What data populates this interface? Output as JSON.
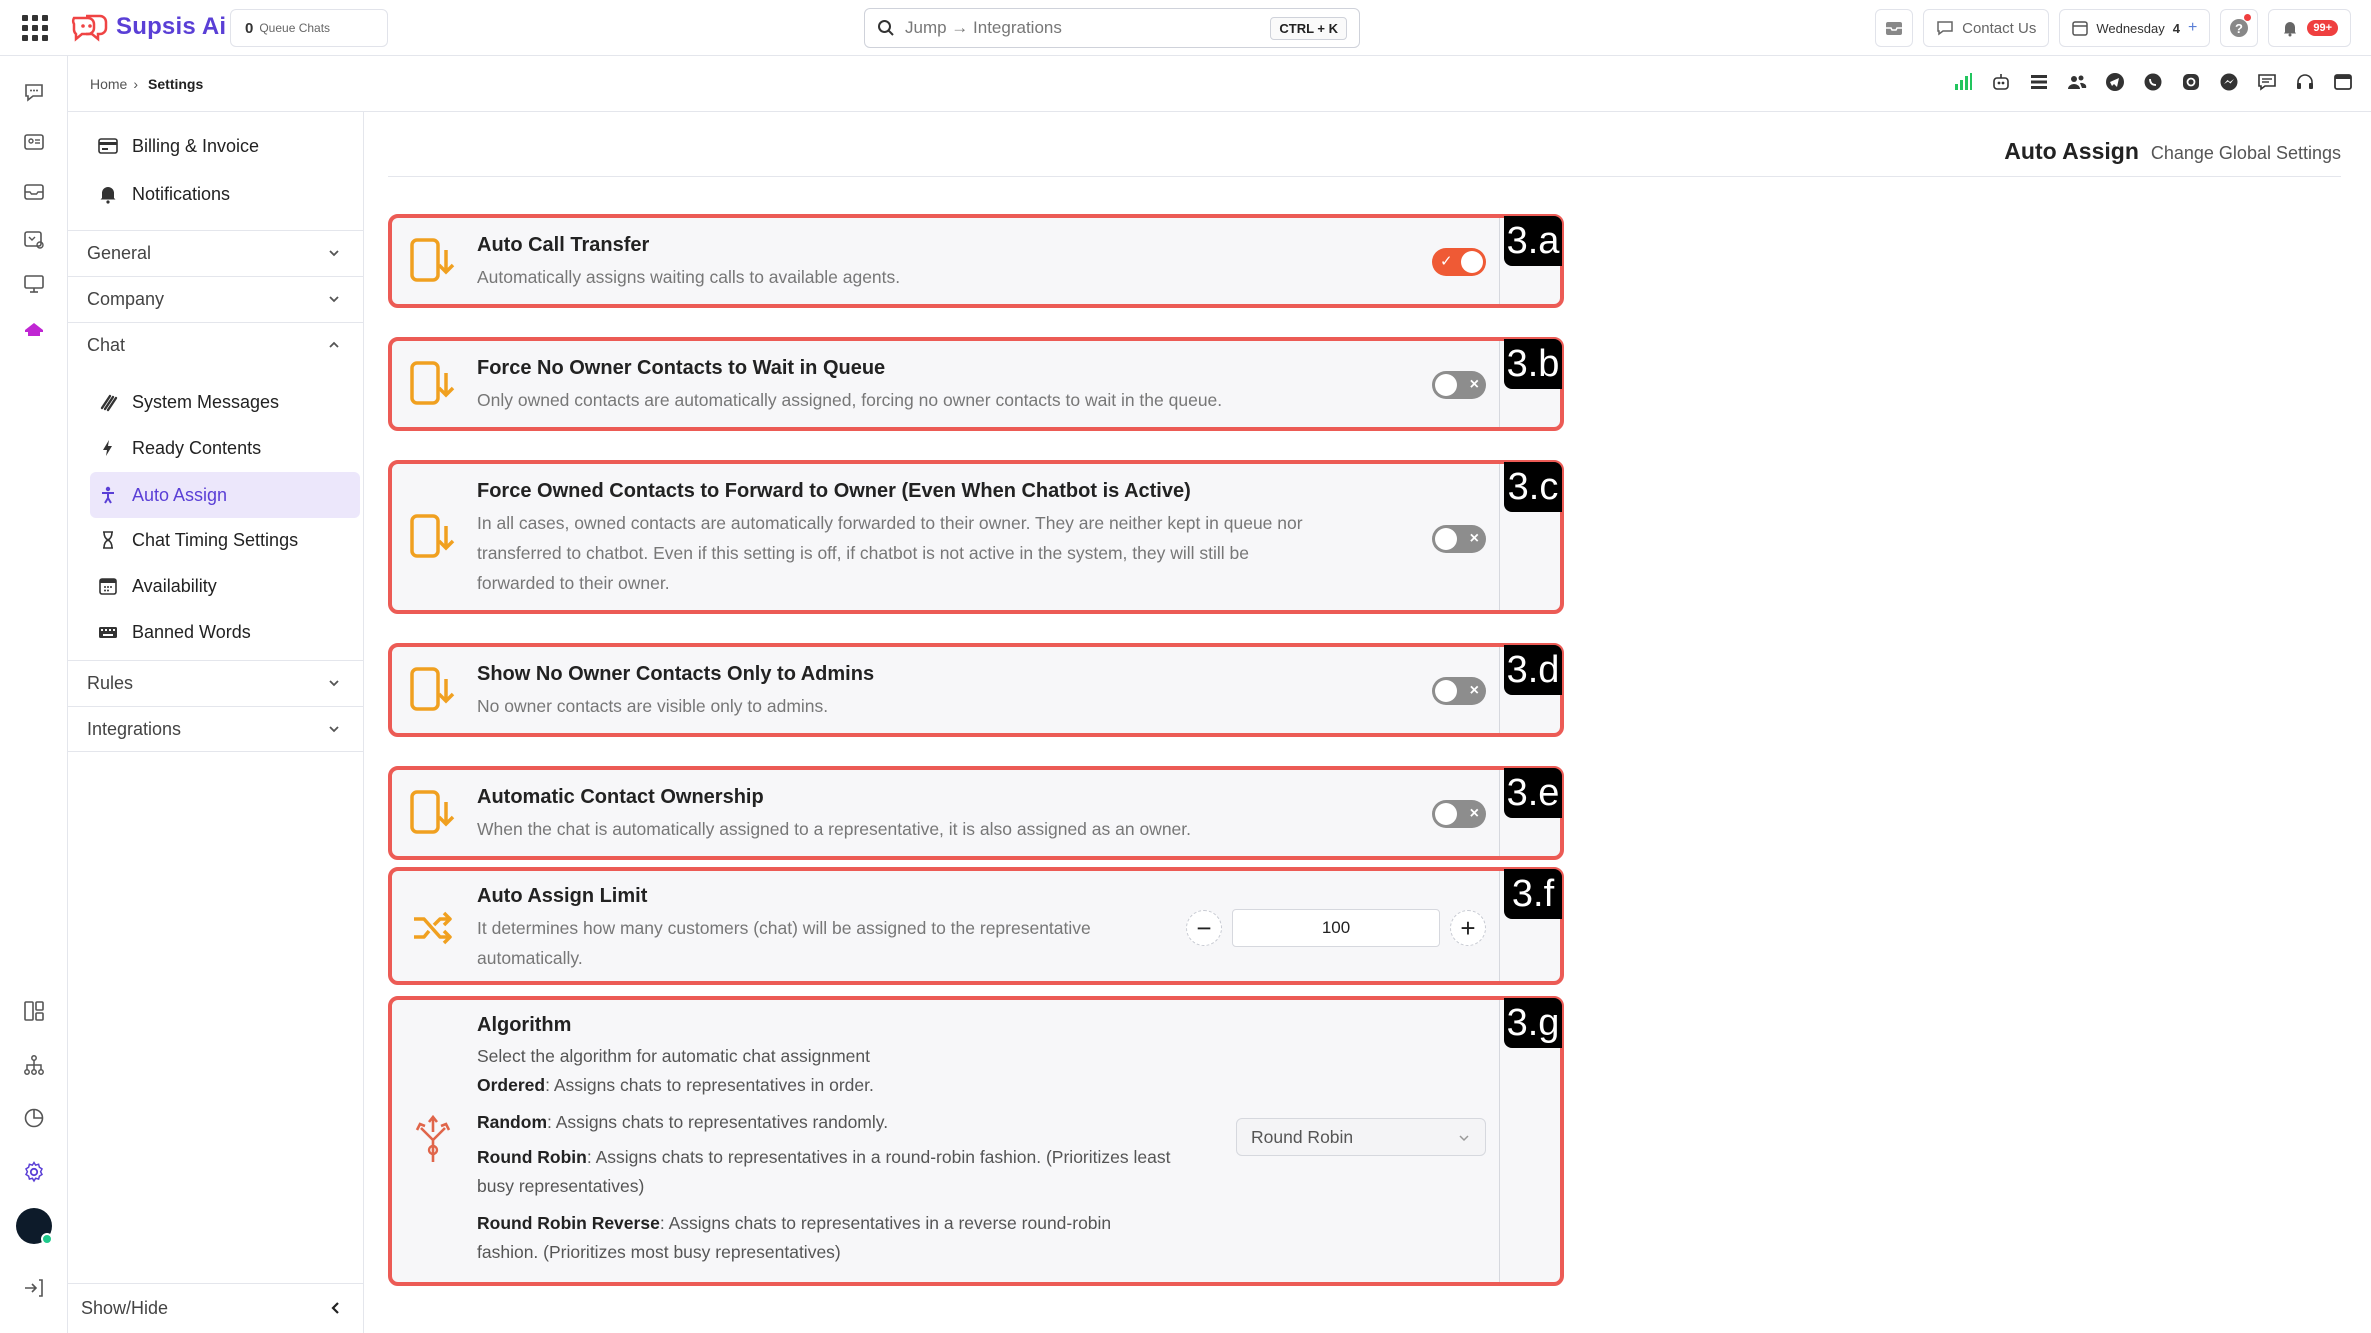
{
  "app": {
    "brand": "Supsis Ai",
    "queue_count": "0",
    "queue_label": "Queue Chats",
    "search_placeholder": "Jump → Integrations",
    "search_shortcut": "CTRL + K",
    "contact_us": "Contact Us",
    "day": "Wednesday",
    "day_num": "4",
    "notif_badge": "99+"
  },
  "breadcrumb": {
    "home": "Home",
    "sep": "›",
    "current": "Settings"
  },
  "menu": {
    "top_items": [
      {
        "label": "Billing & Invoice",
        "icon": "invoice-icon"
      },
      {
        "label": "Notifications",
        "icon": "bell-icon"
      }
    ],
    "sections": [
      "General",
      "Company",
      "Chat",
      "Rules",
      "Integrations"
    ],
    "chat_items": [
      {
        "label": "System Messages",
        "icon": "wave-icon"
      },
      {
        "label": "Ready Contents",
        "icon": "bolt-icon"
      },
      {
        "label": "Auto Assign",
        "icon": "person-assign-icon",
        "active": true
      },
      {
        "label": "Chat Timing Settings",
        "icon": "hourglass-icon"
      },
      {
        "label": "Availability",
        "icon": "calendar-icon"
      },
      {
        "label": "Banned Words",
        "icon": "keyboard-icon"
      }
    ],
    "show_hide": "Show/Hide"
  },
  "page": {
    "title": "Auto Assign",
    "subtitle": "Change Global Settings"
  },
  "settings": [
    {
      "tag": "3.a",
      "title": "Auto Call Transfer",
      "desc": "Automatically assigns waiting calls to available agents.",
      "enabled": true
    },
    {
      "tag": "3.b",
      "title": "Force No Owner Contacts to Wait in Queue",
      "desc": "Only owned contacts are automatically assigned, forcing no owner contacts to wait in the queue.",
      "enabled": false
    },
    {
      "tag": "3.c",
      "title": "Force Owned Contacts to Forward to Owner (Even When Chatbot is Active)",
      "desc_lines": [
        "In all cases, owned contacts are automatically forwarded to their owner. They are neither kept in queue nor",
        "transferred to chatbot. Even if this setting is off, if chatbot is not active in the system, they will still be",
        "forwarded to their owner."
      ],
      "enabled": false
    },
    {
      "tag": "3.d",
      "title": "Show No Owner Contacts Only to Admins",
      "desc": "No owner contacts are visible only to admins.",
      "enabled": false
    },
    {
      "tag": "3.e",
      "title": "Automatic Contact Ownership",
      "desc": "When the chat is automatically assigned to a representative, it is also assigned as an owner.",
      "enabled": false
    }
  ],
  "limit": {
    "tag": "3.f",
    "title": "Auto Assign Limit",
    "desc_lines": [
      "It determines how many customers (chat) will be assigned to the representative",
      "automatically."
    ],
    "minus": "−",
    "plus": "+",
    "value": "100"
  },
  "algorithm": {
    "tag": "3.g",
    "title": "Algorithm",
    "intro": "Select the algorithm for automatic chat assignment",
    "options": [
      {
        "name": "Ordered",
        "desc": ": Assigns chats to representatives in order."
      },
      {
        "name": "Random",
        "desc": ": Assigns chats to representatives randomly."
      },
      {
        "name": "Round Robin",
        "desc": ": Assigns chats to representatives in a round-robin fashion. (Prioritizes least",
        "desc2": "busy representatives)"
      },
      {
        "name": "Round Robin Reverse",
        "desc": ": Assigns chats to representatives in a reverse round-robin",
        "desc2": "fashion. (Prioritizes most busy representatives)"
      }
    ],
    "selected": "Round Robin"
  },
  "colors": {
    "accent": "#5a3fd6",
    "highlight_border": "#ec5b55",
    "icon_orange": "#f0a020",
    "toggle_on": "#ef5a35"
  }
}
